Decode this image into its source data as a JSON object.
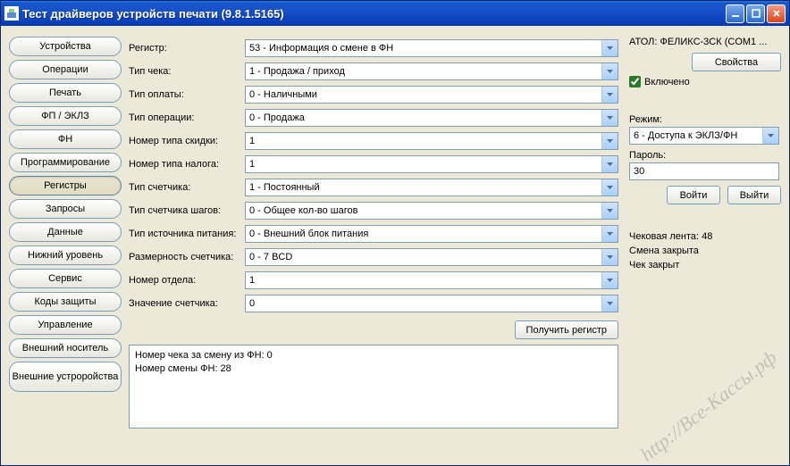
{
  "window": {
    "title": "Тест драйверов устройств печати (9.8.1.5165)"
  },
  "sidebar": {
    "items": [
      {
        "label": "Устройства",
        "name": "devices"
      },
      {
        "label": "Операции",
        "name": "operations"
      },
      {
        "label": "Печать",
        "name": "print"
      },
      {
        "label": "ФП / ЭКЛЗ",
        "name": "fp-eklz"
      },
      {
        "label": "ФН",
        "name": "fn"
      },
      {
        "label": "Программирование",
        "name": "programming"
      },
      {
        "label": "Регистры",
        "name": "registers"
      },
      {
        "label": "Запросы",
        "name": "queries"
      },
      {
        "label": "Данные",
        "name": "data"
      },
      {
        "label": "Нижний уровень",
        "name": "low-level"
      },
      {
        "label": "Сервис",
        "name": "service"
      },
      {
        "label": "Коды защиты",
        "name": "protection-codes"
      },
      {
        "label": "Управление",
        "name": "control"
      },
      {
        "label": "Внешний носитель",
        "name": "external-media"
      },
      {
        "label": "Внешние устроройства",
        "name": "external-devices"
      }
    ]
  },
  "form": {
    "rows": [
      {
        "label": "Регистр:",
        "value": "53 - Информация о смене в ФН",
        "name": "register"
      },
      {
        "label": "Тип чека:",
        "value": "1 - Продажа / приход",
        "name": "check-type"
      },
      {
        "label": "Тип оплаты:",
        "value": "0 - Наличными",
        "name": "payment-type"
      },
      {
        "label": "Тип операции:",
        "value": "0 - Продажа",
        "name": "operation-type"
      },
      {
        "label": "Номер типа скидки:",
        "value": "1",
        "name": "discount-type-no"
      },
      {
        "label": "Номер типа налога:",
        "value": "1",
        "name": "tax-type-no"
      },
      {
        "label": "Тип счетчика:",
        "value": "1 - Постоянный",
        "name": "counter-type"
      },
      {
        "label": "Тип счетчика шагов:",
        "value": "0 - Общее кол-во шагов",
        "name": "step-counter-type"
      },
      {
        "label": "Тип источника питания:",
        "value": "0 - Внешний блок питания",
        "name": "power-source-type"
      },
      {
        "label": "Размерность счетчика:",
        "value": "0 - 7 BCD",
        "name": "counter-dimension"
      },
      {
        "label": "Номер отдела:",
        "value": "1",
        "name": "department-no"
      },
      {
        "label": "Значение счетчика:",
        "value": "0",
        "name": "counter-value"
      }
    ],
    "get_register_btn": "Получить регистр",
    "output_line1": "Номер чека за смену из ФН: 0",
    "output_line2": "Номер смены ФН: 28"
  },
  "right": {
    "device": "АТОЛ: ФЕЛИКС-3СК (COM1 ...",
    "properties_btn": "Свойства",
    "enabled_label": "Включено",
    "mode_label": "Режим:",
    "mode_value": "6 - Доступа к ЭКЛЗ/ФН",
    "password_label": "Пароль:",
    "password_value": "30",
    "enter_btn": "Войти",
    "exit_btn": "Выйти",
    "status_line1": "Чековая лента: 48",
    "status_line2": "Смена закрыта",
    "status_line3": "Чек закрыт"
  },
  "watermark": "http://Все-Кассы.рф"
}
